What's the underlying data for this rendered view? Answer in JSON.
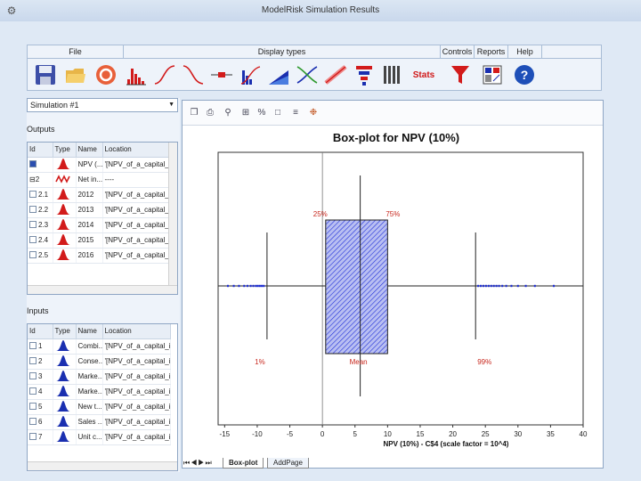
{
  "window": {
    "title": "ModelRisk Simulation Results"
  },
  "ribbon": {
    "groups": [
      {
        "label": "File"
      },
      {
        "label": "Display types"
      },
      {
        "label": "Controls"
      },
      {
        "label": "Reports"
      },
      {
        "label": "Help"
      }
    ],
    "stats_label": "Stats"
  },
  "simulation_select": {
    "value": "Simulation #1"
  },
  "outputs": {
    "label": "Outputs",
    "columns": [
      "Id",
      "Type",
      "Name",
      "Location"
    ],
    "rows": [
      {
        "id": "",
        "type": "red-hist",
        "name": "NPV (...",
        "location": "'[NPV_of_a_capital_..."
      },
      {
        "id": "2",
        "type": "red-wave",
        "name": "Net in...",
        "location": "----"
      },
      {
        "id": "2.1",
        "type": "red-hist",
        "name": "2012",
        "location": "'[NPV_of_a_capital_..."
      },
      {
        "id": "2.2",
        "type": "red-hist",
        "name": "2013",
        "location": "'[NPV_of_a_capital_..."
      },
      {
        "id": "2.3",
        "type": "red-hist",
        "name": "2014",
        "location": "'[NPV_of_a_capital_..."
      },
      {
        "id": "2.4",
        "type": "red-hist",
        "name": "2015",
        "location": "'[NPV_of_a_capital_..."
      },
      {
        "id": "2.5",
        "type": "red-hist",
        "name": "2016",
        "location": "'[NPV_of_a_capital_..."
      }
    ]
  },
  "inputs": {
    "label": "Inputs",
    "columns": [
      "Id",
      "Type",
      "Name",
      "Location"
    ],
    "rows": [
      {
        "id": "1",
        "name": "Combi...",
        "location": "'[NPV_of_a_capital_inve"
      },
      {
        "id": "2",
        "name": "Conse...",
        "location": "'[NPV_of_a_capital_inve"
      },
      {
        "id": "3",
        "name": "Marke...",
        "location": "'[NPV_of_a_capital_inve"
      },
      {
        "id": "4",
        "name": "Marke...",
        "location": "'[NPV_of_a_capital_inve"
      },
      {
        "id": "5",
        "name": "New t...",
        "location": "'[NPV_of_a_capital_inve"
      },
      {
        "id": "6",
        "name": "Sales ...",
        "location": "'[NPV_of_a_capital_inve"
      },
      {
        "id": "7",
        "name": "Unit c...",
        "location": "'[NPV_of_a_capital_inve"
      }
    ]
  },
  "chart_data": {
    "type": "boxplot",
    "title": "Box-plot for NPV (10%)",
    "xlabel": "NPV (10%) - C$4 (scale factor = 10^4)",
    "xlim": [
      -16,
      40
    ],
    "xticks": [
      -15,
      -10,
      -5,
      0,
      5,
      10,
      15,
      20,
      25,
      30,
      35,
      40
    ],
    "whisker_low": -8.5,
    "q1": 0.5,
    "mean": 5.8,
    "median": 5.8,
    "q3": 10,
    "whisker_high": 23.5,
    "outliers": [
      -14.5,
      -13.6,
      -12.8,
      -12.0,
      -11.5,
      -11.0,
      -10.6,
      -10.2,
      -9.9,
      -9.6,
      -9.3,
      -9.0,
      23.9,
      24.3,
      24.7,
      25.1,
      25.5,
      25.9,
      26.3,
      26.7,
      27.1,
      27.6,
      28.2,
      29.0,
      30.0,
      31.2,
      32.6,
      35.5
    ],
    "labels": {
      "p1": "1%",
      "p25": "25%",
      "p75": "75%",
      "mean": "Mean",
      "p99": "99%"
    },
    "colors": {
      "box": "#1f2fd8",
      "labels": "#c8281e",
      "outliers": "#1f2fd8"
    }
  },
  "sheet_tabs": [
    "Box-plot",
    "AddPage"
  ]
}
